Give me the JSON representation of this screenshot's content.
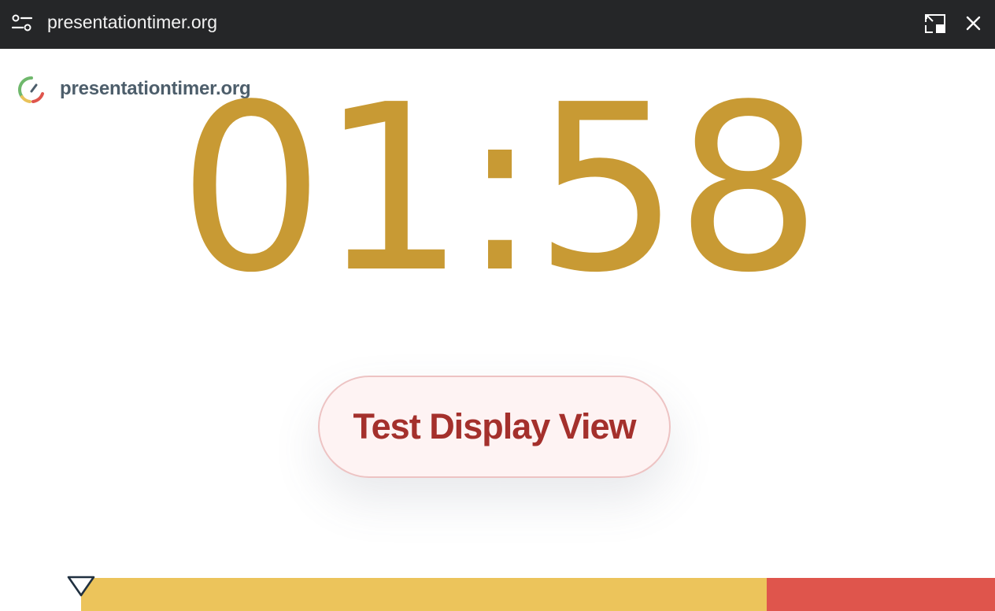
{
  "window": {
    "title": "presentationtimer.org",
    "icons": {
      "controls": "sliders-icon",
      "pip": "picture-in-picture-icon",
      "close": "close-icon"
    }
  },
  "brand": {
    "name": "presentationtimer.org",
    "logo_colors": [
      "#6fb86c",
      "#e9c25a",
      "#df554c",
      "#4d5e6b"
    ]
  },
  "timer": {
    "display": "01:58",
    "color": "#c89a34"
  },
  "test_button": {
    "label": "Test Display View",
    "text_color": "#a4302c",
    "background": "#fef3f3"
  },
  "progress": {
    "elapsed_fraction": 0,
    "segments": [
      {
        "name": "warning",
        "color": "#ecc45b",
        "fraction": 0.75
      },
      {
        "name": "overtime",
        "color": "#df554c",
        "fraction": 0.25
      }
    ]
  }
}
